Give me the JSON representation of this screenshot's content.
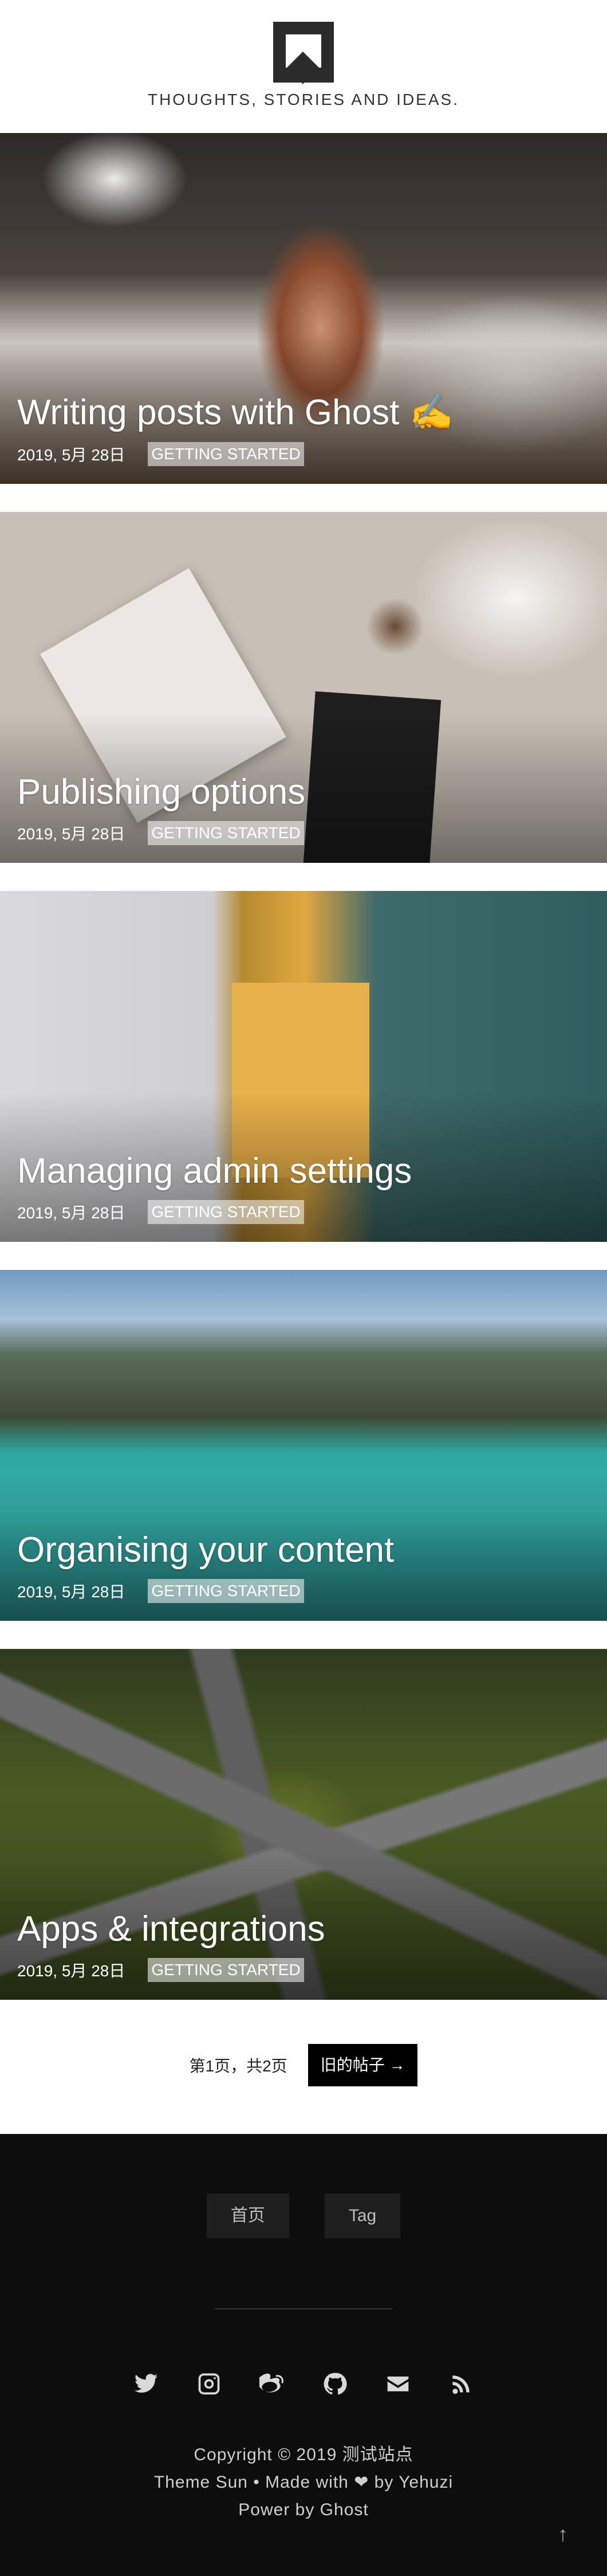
{
  "header": {
    "description": "THOUGHTS, STORIES AND IDEAS."
  },
  "posts": [
    {
      "title": "Writing posts with Ghost ✍️",
      "date": "2019, 5月 28日",
      "tag": "GETTING STARTED"
    },
    {
      "title": "Publishing options",
      "date": "2019, 5月 28日",
      "tag": "GETTING STARTED"
    },
    {
      "title": "Managing admin settings",
      "date": "2019, 5月 28日",
      "tag": "GETTING STARTED"
    },
    {
      "title": "Organising your content",
      "date": "2019, 5月 28日",
      "tag": "GETTING STARTED"
    },
    {
      "title": "Apps & integrations",
      "date": "2019, 5月 28日",
      "tag": "GETTING STARTED"
    }
  ],
  "pagination": {
    "page_info": "第1页，共2页",
    "older_label": "旧的帖子 →"
  },
  "footer": {
    "nav": [
      {
        "label": "首页"
      },
      {
        "label": "Tag"
      }
    ],
    "social_icons": [
      "twitter-icon",
      "instagram-icon",
      "weibo-icon",
      "github-icon",
      "email-icon",
      "rss-icon"
    ],
    "copyright": "Copyright © 2019 测试站点",
    "theme_line": "Theme Sun • Made with ❤ by Yehuzi",
    "powered": "Power by Ghost",
    "back_to_top": "↑"
  },
  "colors": {
    "footer_bg": "#0d0d0d",
    "button_bg": "#000000",
    "tag_bg": "rgba(255,255,255,0.55)"
  }
}
